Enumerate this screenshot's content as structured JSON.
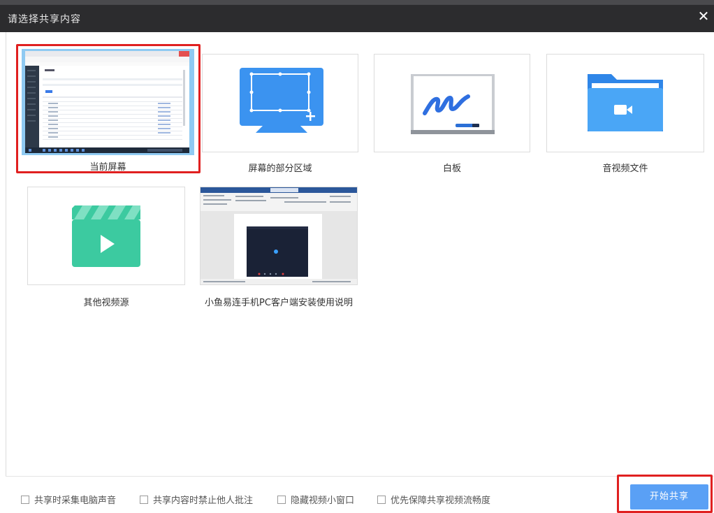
{
  "dialog": {
    "title": "请选择共享内容",
    "close_icon": "✕"
  },
  "sources": [
    {
      "label": "当前屏幕",
      "icon": "desktop-screenshot-icon",
      "selected": true
    },
    {
      "label": "屏幕的部分区域",
      "icon": "screen-region-icon",
      "selected": false
    },
    {
      "label": "白板",
      "icon": "whiteboard-icon",
      "selected": false
    },
    {
      "label": "音视频文件",
      "icon": "media-folder-icon",
      "selected": false
    },
    {
      "label": "其他视频源",
      "icon": "video-clapper-icon",
      "selected": false
    },
    {
      "label": "小鱼易连手机PC客户端安装使用说明",
      "icon": "word-document-window-icon",
      "selected": false
    }
  ],
  "footer": {
    "options": [
      {
        "label": "共享时采集电脑声音",
        "checked": false
      },
      {
        "label": "共享内容时禁止他人批注",
        "checked": false
      },
      {
        "label": "隐藏视频小窗口",
        "checked": false
      },
      {
        "label": "优先保障共享视频流畅度",
        "checked": false
      }
    ],
    "start_button": "开始共享"
  },
  "colors": {
    "accent_blue": "#5aa0f5",
    "highlight_red": "#e02020",
    "titlebar": "#2c2c2e",
    "icon_blue": "#3b93f0",
    "icon_green": "#3ccaa0"
  }
}
